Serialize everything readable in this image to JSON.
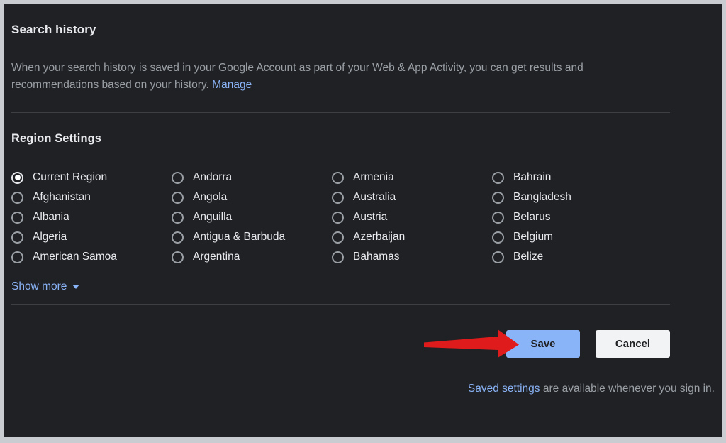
{
  "search_history": {
    "title": "Search history",
    "description_part1": "When your search history is saved in your Google Account as part of your Web & App Activity, you can get results and recommendations based on your history. ",
    "manage_link": "Manage"
  },
  "region_settings": {
    "title": "Region Settings",
    "columns": [
      {
        "options": [
          {
            "label": "Current Region",
            "checked": true
          },
          {
            "label": "Afghanistan",
            "checked": false
          },
          {
            "label": "Albania",
            "checked": false
          },
          {
            "label": "Algeria",
            "checked": false
          },
          {
            "label": "American Samoa",
            "checked": false
          }
        ]
      },
      {
        "options": [
          {
            "label": "Andorra",
            "checked": false
          },
          {
            "label": "Angola",
            "checked": false
          },
          {
            "label": "Anguilla",
            "checked": false
          },
          {
            "label": "Antigua & Barbuda",
            "checked": false
          },
          {
            "label": "Argentina",
            "checked": false
          }
        ]
      },
      {
        "options": [
          {
            "label": "Armenia",
            "checked": false
          },
          {
            "label": "Australia",
            "checked": false
          },
          {
            "label": "Austria",
            "checked": false
          },
          {
            "label": "Azerbaijan",
            "checked": false
          },
          {
            "label": "Bahamas",
            "checked": false
          }
        ]
      },
      {
        "options": [
          {
            "label": "Bahrain",
            "checked": false
          },
          {
            "label": "Bangladesh",
            "checked": false
          },
          {
            "label": "Belarus",
            "checked": false
          },
          {
            "label": "Belgium",
            "checked": false
          },
          {
            "label": "Belize",
            "checked": false
          }
        ]
      }
    ],
    "show_more_label": "Show more",
    "show_more_icon": "caret-down-icon"
  },
  "actions": {
    "save_label": "Save",
    "cancel_label": "Cancel"
  },
  "footnote": {
    "link_text": "Saved settings",
    "rest_text": " are available whenever you sign in."
  },
  "annotation": {
    "type": "red-arrow",
    "points_to": "save-button",
    "color": "#e01b1b"
  },
  "colors": {
    "background": "#202124",
    "text_primary": "#e8eaed",
    "text_secondary": "#9aa0a6",
    "link": "#8ab4f8",
    "accent_button": "#8ab4f8",
    "secondary_button": "#f1f3f4",
    "divider": "#3c4043",
    "frame": "#c9cdd1"
  }
}
